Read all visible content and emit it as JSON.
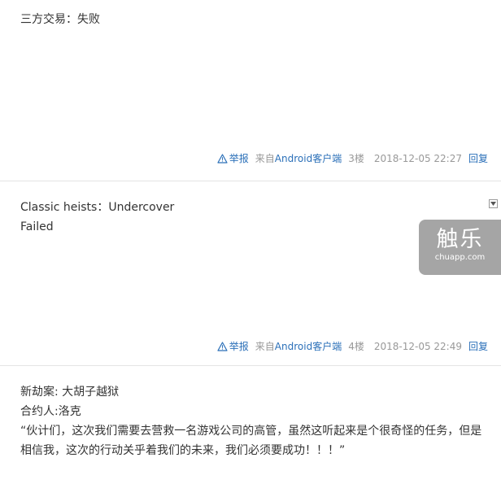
{
  "posts": [
    {
      "lines": [
        "三方交易：失败"
      ],
      "meta": {
        "report_label": "举报",
        "source_prefix": "来自",
        "source_link": "Android客户端",
        "floor": "3楼",
        "time": "2018-12-05 22:27",
        "reply_label": "回复"
      }
    },
    {
      "lines": [
        "Classic heists：Undercover",
        "Failed"
      ],
      "meta": {
        "report_label": "举报",
        "source_prefix": "来自",
        "source_link": "Android客户端",
        "floor": "4楼",
        "time": "2018-12-05 22:49",
        "reply_label": "回复"
      }
    },
    {
      "lines": [
        "新劫案: 大胡子越狱",
        "合约人:洛克",
        "“伙计们，这次我们需要去营救一名游戏公司的高管，虽然这听起来是个很奇怪的任务，但是相信我，这次的行动关乎着我们的未来，我们必须要成功！！！”"
      ]
    }
  ],
  "watermark": {
    "main": "触乐",
    "sub": "chuapp.com"
  },
  "colors": {
    "link": "#2a6fb8",
    "meta_gray": "#999999",
    "text": "#333333",
    "divider": "#e4e4e4"
  },
  "icons": {
    "report": "warning-triangle-icon",
    "dropdown": "caret-down-icon"
  }
}
